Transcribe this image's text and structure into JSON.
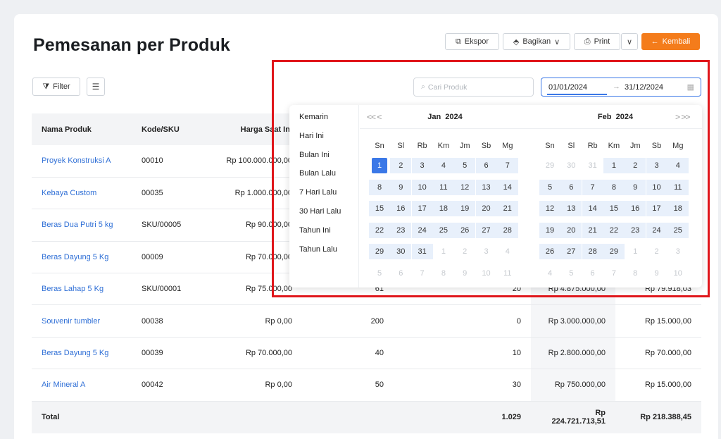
{
  "page_title": "Pemesanan per Produk",
  "toolbar": {
    "ekspor": "Ekspor",
    "bagikan": "Bagikan",
    "print": "Print",
    "kembali": "Kembali"
  },
  "filter_label": "Filter",
  "search": {
    "placeholder": "Cari Produk"
  },
  "date_range": {
    "start": "01/01/2024",
    "end": "31/12/2024"
  },
  "table": {
    "headers": [
      "Nama Produk",
      "Kode/SKU",
      "Harga Saat Ini"
    ],
    "rows": [
      {
        "name": "Proyek Konstruksi A",
        "sku": "00010",
        "price": "Rp 100.000.000,00",
        "c4": "",
        "c5": "",
        "c6": "",
        "c7": ""
      },
      {
        "name": "Kebaya Custom",
        "sku": "00035",
        "price": "Rp 1.000.000,00",
        "c4": "",
        "c5": "",
        "c6": "",
        "c7": ""
      },
      {
        "name": "Beras Dua Putri 5 kg",
        "sku": "SKU/00005",
        "price": "Rp 90.000,00",
        "c4": "",
        "c5": "",
        "c6": "",
        "c7": ""
      },
      {
        "name": "Beras Dayung 5 Kg",
        "sku": "00009",
        "price": "Rp 70.000,00",
        "c4": "",
        "c5": "",
        "c6": "",
        "c7": ""
      },
      {
        "name": "Beras Lahap 5 Kg",
        "sku": "SKU/00001",
        "price": "Rp 75.000,00",
        "c4": "61",
        "c5": "20",
        "c6": "Rp 4.875.000,00",
        "c7": "Rp 79.918,03"
      },
      {
        "name": "Souvenir tumbler",
        "sku": "00038",
        "price": "Rp 0,00",
        "c4": "200",
        "c5": "0",
        "c6": "Rp 3.000.000,00",
        "c7": "Rp 15.000,00"
      },
      {
        "name": "Beras Dayung 5 Kg",
        "sku": "00039",
        "price": "Rp 70.000,00",
        "c4": "40",
        "c5": "10",
        "c6": "Rp 2.800.000,00",
        "c7": "Rp 70.000,00"
      },
      {
        "name": "Air Mineral A",
        "sku": "00042",
        "price": "Rp 0,00",
        "c4": "50",
        "c5": "30",
        "c6": "Rp 750.000,00",
        "c7": "Rp 15.000,00"
      }
    ],
    "total": {
      "label": "Total",
      "c5": "1.029",
      "c6": "Rp 224.721.713,51",
      "c7": "Rp 218.388,45"
    }
  },
  "picker": {
    "presets": [
      "Kemarin",
      "Hari Ini",
      "Bulan Ini",
      "Bulan Lalu",
      "7 Hari Lalu",
      "30 Hari Lalu",
      "Tahun Ini",
      "Tahun Lalu"
    ],
    "weekdays": [
      "Sn",
      "Sl",
      "Rb",
      "Km",
      "Jm",
      "Sb",
      "Mg"
    ],
    "nav_prev": "<< <",
    "nav_next": "> >>",
    "months": [
      {
        "name": "Jan",
        "year": "2024",
        "days": [
          [
            {
              "d": "1",
              "s": "sel"
            },
            {
              "d": "2",
              "s": "in"
            },
            {
              "d": "3",
              "s": "in"
            },
            {
              "d": "4",
              "s": "in"
            },
            {
              "d": "5",
              "s": "in"
            },
            {
              "d": "6",
              "s": "in"
            },
            {
              "d": "7",
              "s": "in"
            }
          ],
          [
            {
              "d": "8",
              "s": "in"
            },
            {
              "d": "9",
              "s": "in"
            },
            {
              "d": "10",
              "s": "in"
            },
            {
              "d": "11",
              "s": "in"
            },
            {
              "d": "12",
              "s": "in"
            },
            {
              "d": "13",
              "s": "in"
            },
            {
              "d": "14",
              "s": "in"
            }
          ],
          [
            {
              "d": "15",
              "s": "in"
            },
            {
              "d": "16",
              "s": "in"
            },
            {
              "d": "17",
              "s": "in"
            },
            {
              "d": "18",
              "s": "in"
            },
            {
              "d": "19",
              "s": "in"
            },
            {
              "d": "20",
              "s": "in"
            },
            {
              "d": "21",
              "s": "in"
            }
          ],
          [
            {
              "d": "22",
              "s": "in"
            },
            {
              "d": "23",
              "s": "in"
            },
            {
              "d": "24",
              "s": "in"
            },
            {
              "d": "25",
              "s": "in"
            },
            {
              "d": "26",
              "s": "in"
            },
            {
              "d": "27",
              "s": "in"
            },
            {
              "d": "28",
              "s": "in"
            }
          ],
          [
            {
              "d": "29",
              "s": "in"
            },
            {
              "d": "30",
              "s": "in"
            },
            {
              "d": "31",
              "s": "in"
            },
            {
              "d": "1",
              "s": "out"
            },
            {
              "d": "2",
              "s": "out"
            },
            {
              "d": "3",
              "s": "out"
            },
            {
              "d": "4",
              "s": "out"
            }
          ],
          [
            {
              "d": "5",
              "s": "out"
            },
            {
              "d": "6",
              "s": "out"
            },
            {
              "d": "7",
              "s": "out"
            },
            {
              "d": "8",
              "s": "out"
            },
            {
              "d": "9",
              "s": "out"
            },
            {
              "d": "10",
              "s": "out"
            },
            {
              "d": "11",
              "s": "out"
            }
          ]
        ]
      },
      {
        "name": "Feb",
        "year": "2024",
        "days": [
          [
            {
              "d": "29",
              "s": "out"
            },
            {
              "d": "30",
              "s": "out"
            },
            {
              "d": "31",
              "s": "out"
            },
            {
              "d": "1",
              "s": "in"
            },
            {
              "d": "2",
              "s": "in"
            },
            {
              "d": "3",
              "s": "in"
            },
            {
              "d": "4",
              "s": "in"
            }
          ],
          [
            {
              "d": "5",
              "s": "in"
            },
            {
              "d": "6",
              "s": "in"
            },
            {
              "d": "7",
              "s": "in"
            },
            {
              "d": "8",
              "s": "in"
            },
            {
              "d": "9",
              "s": "in"
            },
            {
              "d": "10",
              "s": "in"
            },
            {
              "d": "11",
              "s": "in"
            }
          ],
          [
            {
              "d": "12",
              "s": "in"
            },
            {
              "d": "13",
              "s": "in"
            },
            {
              "d": "14",
              "s": "in"
            },
            {
              "d": "15",
              "s": "in"
            },
            {
              "d": "16",
              "s": "in"
            },
            {
              "d": "17",
              "s": "in"
            },
            {
              "d": "18",
              "s": "in"
            }
          ],
          [
            {
              "d": "19",
              "s": "in"
            },
            {
              "d": "20",
              "s": "in"
            },
            {
              "d": "21",
              "s": "in"
            },
            {
              "d": "22",
              "s": "in"
            },
            {
              "d": "23",
              "s": "in"
            },
            {
              "d": "24",
              "s": "in"
            },
            {
              "d": "25",
              "s": "in"
            }
          ],
          [
            {
              "d": "26",
              "s": "in"
            },
            {
              "d": "27",
              "s": "in"
            },
            {
              "d": "28",
              "s": "in"
            },
            {
              "d": "29",
              "s": "in"
            },
            {
              "d": "1",
              "s": "out"
            },
            {
              "d": "2",
              "s": "out"
            },
            {
              "d": "3",
              "s": "out"
            }
          ],
          [
            {
              "d": "4",
              "s": "out"
            },
            {
              "d": "5",
              "s": "out"
            },
            {
              "d": "6",
              "s": "out"
            },
            {
              "d": "7",
              "s": "out"
            },
            {
              "d": "8",
              "s": "out"
            },
            {
              "d": "9",
              "s": "out"
            },
            {
              "d": "10",
              "s": "out"
            }
          ]
        ]
      }
    ]
  },
  "colors": {
    "accent": "#3b78e7",
    "primary_button": "#f47c1b",
    "link": "#2f6fd6",
    "annotation": "#e0161b"
  },
  "icons": [
    "export-icon",
    "share-icon",
    "print-icon",
    "chevron-down-icon",
    "arrow-left-icon",
    "filter-icon",
    "list-icon",
    "search-icon",
    "calendar-icon",
    "arrow-right-icon"
  ]
}
